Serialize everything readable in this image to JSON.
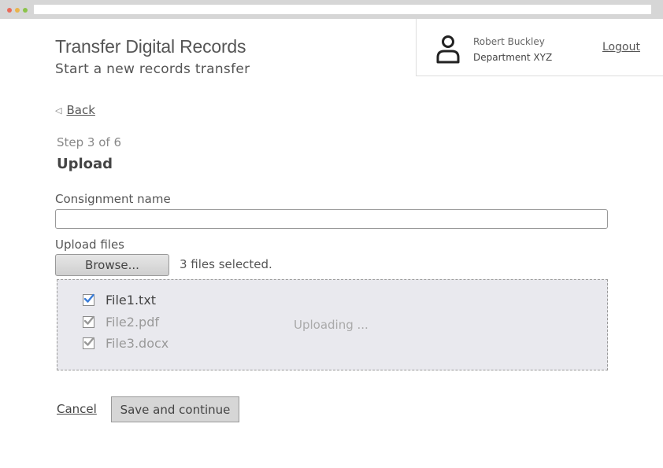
{
  "header": {
    "title": "Transfer Digital Records",
    "subtitle": "Start a new records transfer"
  },
  "user": {
    "name": "Robert Buckley",
    "department": "Department XYZ",
    "logout_label": "Logout",
    "avatar_icon": "user-icon"
  },
  "nav": {
    "back_label": "Back",
    "back_icon": "triangle-left-icon"
  },
  "step": {
    "indicator": "Step 3 of 6",
    "heading": "Upload"
  },
  "form": {
    "consignment_label": "Consignment name",
    "consignment_value": "",
    "upload_label": "Upload files",
    "browse_label": "Browse...",
    "files_selected": "3 files selected."
  },
  "files": [
    {
      "name": "File1.txt",
      "checked": true,
      "active": true
    },
    {
      "name": "File2.pdf",
      "checked": true,
      "active": false
    },
    {
      "name": "File3.docx",
      "checked": true,
      "active": false
    }
  ],
  "upload_status": "Uploading ...",
  "actions": {
    "cancel_label": "Cancel",
    "save_label": "Save and continue"
  },
  "colors": {
    "check_active": "#3b7dd8",
    "check_inactive": "#999999",
    "dropzone_bg": "#e9e9ee"
  }
}
